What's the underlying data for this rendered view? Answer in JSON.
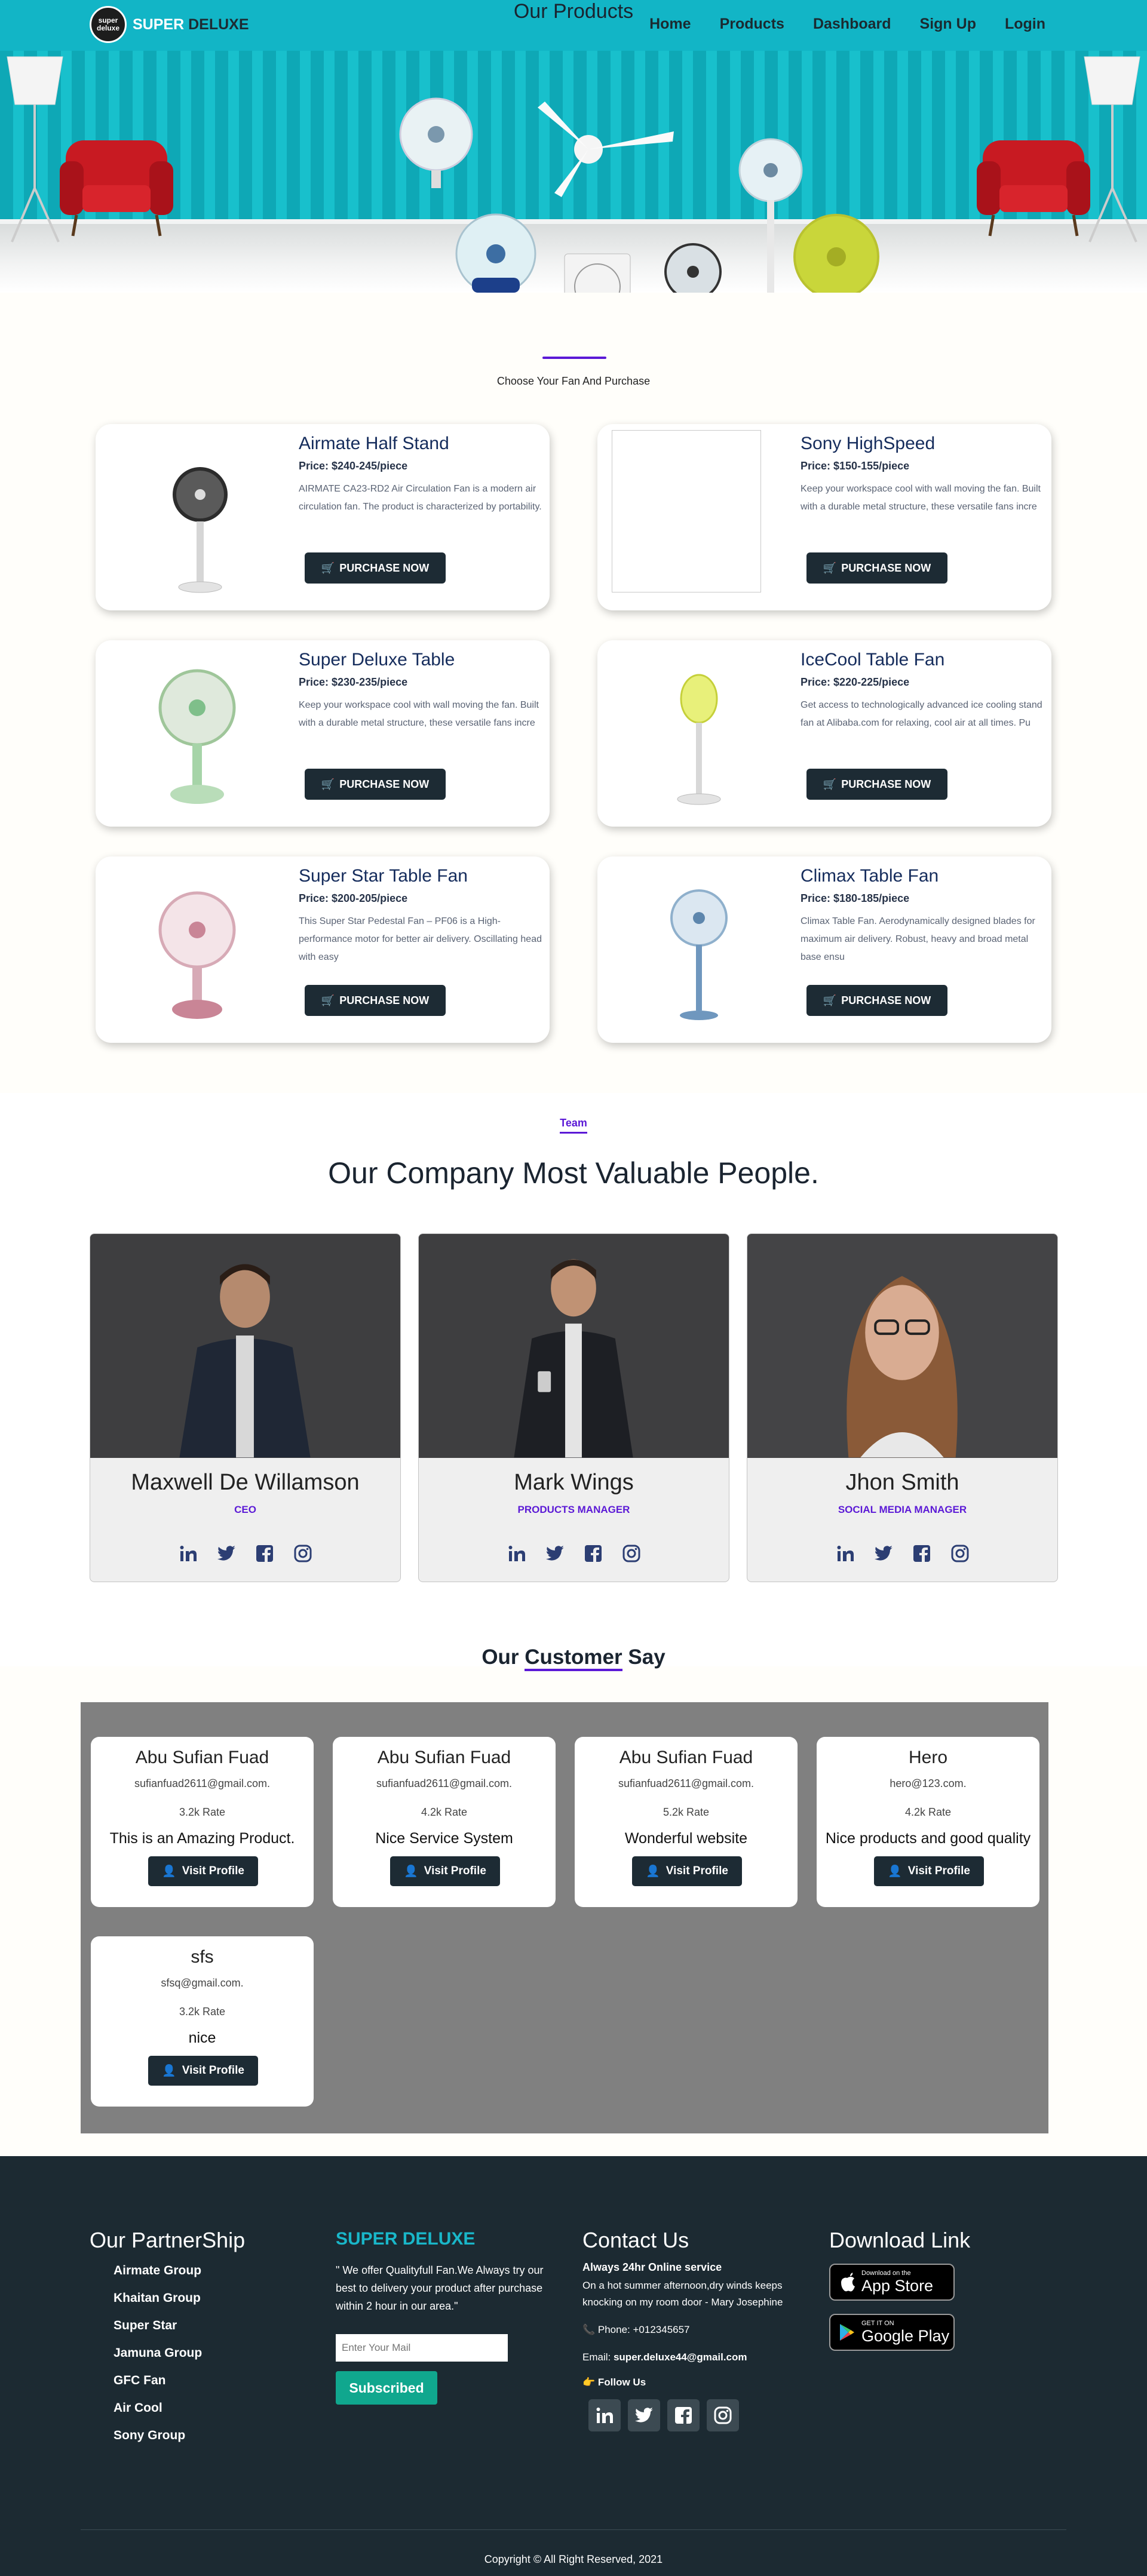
{
  "nav": {
    "logo_line1": "super",
    "logo_line2": "deluxe",
    "brand_part1": "SUPER",
    "brand_part2": " DELUXE",
    "links": [
      "Home",
      "Products",
      "Dashboard",
      "Sign Up",
      "Login"
    ]
  },
  "products": {
    "title": "Our Products",
    "subtitle": "Choose Your Fan And Purchase",
    "button_label": "PURCHASE NOW",
    "items": [
      {
        "name": "Airmate Half Stand",
        "price": "Price: $240-245/piece",
        "desc": "AIRMATE CA23-RD2 Air Circulation Fan is a modern air circulation fan. The product is characterized by portability."
      },
      {
        "name": "Sony HighSpeed",
        "price": "Price: $150-155/piece",
        "desc": "Keep your workspace cool with wall moving the fan. Built with a durable metal structure, these versatile fans incre"
      },
      {
        "name": "Super Deluxe Table",
        "price": "Price: $230-235/piece",
        "desc": "Keep your workspace cool with wall moving the fan. Built with a durable metal structure, these versatile fans incre"
      },
      {
        "name": "IceCool Table Fan",
        "price": "Price: $220-225/piece",
        "desc": "Get access to technologically advanced ice cooling stand fan at Alibaba.com for relaxing, cool air at all times. Pu"
      },
      {
        "name": "Super Star Table Fan",
        "price": "Price: $200-205/piece",
        "desc": "This Super Star Pedestal Fan – PF06 is a High-performance motor for better air delivery. Oscillating head with easy"
      },
      {
        "name": "Climax Table Fan",
        "price": "Price: $180-185/piece",
        "desc": "Climax Table Fan. Aerodynamically designed blades for maximum air delivery. Robust, heavy and broad metal base ensu"
      }
    ]
  },
  "team": {
    "label": "Team",
    "title": "Our Company Most Valuable People.",
    "members": [
      {
        "name": "Maxwell De Willamson",
        "role": "CEO"
      },
      {
        "name": "Mark Wings",
        "role": "PRODUCTS MANAGER"
      },
      {
        "name": "Jhon Smith",
        "role": "SOCIAL MEDIA MANAGER"
      }
    ]
  },
  "customers": {
    "title_prefix": "Our ",
    "title_highlight": "Customer",
    "title_suffix": " Say",
    "button_label": "Visit Profile",
    "reviews": [
      {
        "name": "Abu Sufian Fuad",
        "email": "sufianfuad2611@gmail.com.",
        "rate": "3.2k Rate",
        "text": "This is an Amazing Product."
      },
      {
        "name": "Abu Sufian Fuad",
        "email": "sufianfuad2611@gmail.com.",
        "rate": "4.2k Rate",
        "text": "Nice Service System"
      },
      {
        "name": "Abu Sufian Fuad",
        "email": "sufianfuad2611@gmail.com.",
        "rate": "5.2k Rate",
        "text": "Wonderful website"
      },
      {
        "name": "Hero",
        "email": "hero@123.com.",
        "rate": "4.2k Rate",
        "text": "Nice products and good quality"
      },
      {
        "name": "sfs",
        "email": "sfsq@gmail.com.",
        "rate": "3.2k Rate",
        "text": "nice"
      }
    ]
  },
  "footer": {
    "partners_title": "Our PartnerShip",
    "partners": [
      "Airmate Group",
      "Khaitan Group",
      "Super Star",
      "Jamuna Group",
      "GFC Fan",
      "Air Cool",
      "Sony Group"
    ],
    "brand": "SUPER DELUXE",
    "quote": "\" We offer Qualityfull Fan.We Always try our best to delivery your product after purchase within 2 hour in our area.\"",
    "mail_placeholder": "Enter Your Mail",
    "subscribe_label": "Subscribed",
    "contact_title": "Contact Us",
    "contact_service": "Always 24hr Online service",
    "contact_text": "On a hot summer afternoon,dry winds keeps knocking on my room door - Mary Josephine",
    "phone": "Phone: +012345657",
    "email_label": "Email: ",
    "email_value": "super.deluxe44@gmail.com",
    "follow": "Follow Us",
    "download_title": "Download Link",
    "appstore_small": "Download on the",
    "appstore_big": "App Store",
    "googleplay_small": "GET IT ON",
    "googleplay_big": "Google Play",
    "copyright": "Copyright © All Right Reserved, 2021"
  }
}
